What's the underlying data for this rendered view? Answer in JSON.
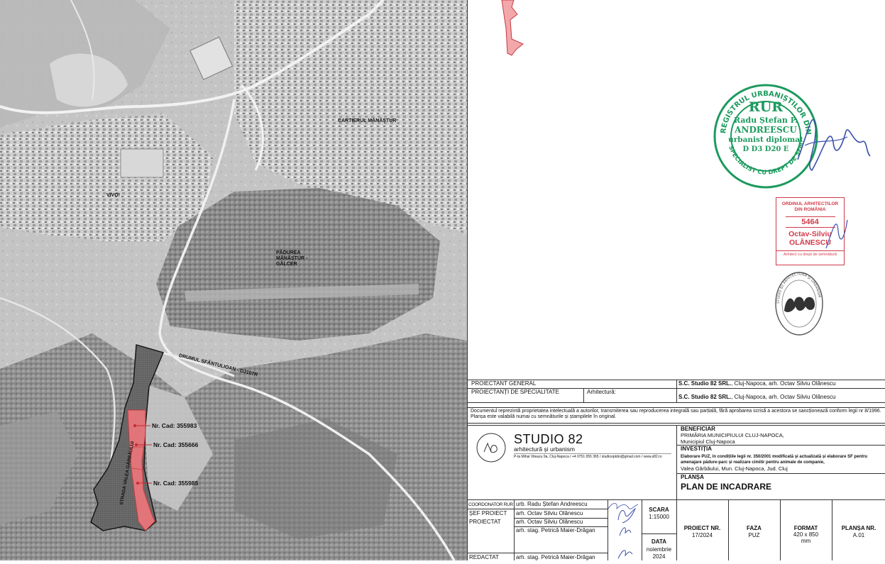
{
  "map": {
    "labels": {
      "cartierul_manastur": "CARTIERUL MĂNĂȘTUR",
      "vivo": "VIVO!",
      "padurea": [
        "PĂDUREA",
        "MĂNĂȘTUR -",
        "GÂLCER"
      ],
      "drumul": "DRUMUL SFÂNTULIOAN - DJ107R",
      "strada": "STRADA VALEA GÂRBĂULUI"
    },
    "cadastral": [
      "Nr. Cad: 355983",
      "Nr. Cad: 355666",
      "Nr. Cad: 355985"
    ]
  },
  "stamps": {
    "rur": {
      "ring_text": "REGISTRUL URBANIȘTILOR DIN ROMÂNIA",
      "ring_bottom": "SPECIALIST CU DREPT DE SEMNĂTURĂ",
      "title": "RUR",
      "name1": "Radu Ștefan P.",
      "name2": "ANDREESCU",
      "role": "urbanist diplomat",
      "codes": "D D3 D20 E"
    },
    "oar": {
      "line1": "ORDINUL ARHITECȚILOR",
      "line2": "DIN ROMÂNIA",
      "number": "5464",
      "name1": "Octav-Silviu",
      "name2": "OLĂNESCU",
      "footer": "Arhitect cu drept de semnătură"
    },
    "company_stamp_text": "STUDIO 82 ARHITECTURĂ ȘI URBANISM"
  },
  "titleblock": {
    "proiectant_general_label": "PROIECTANT GENERAL",
    "proiectant_general_value_bold": "S.C. Studio 82 SRL.",
    "proiectant_general_value": ", Cluj-Napoca, arh. Octav Silviu Olănescu",
    "specialitate_label": "PROIECTANȚI DE SPECIALITATE",
    "specialitate_sub": "Arhitectură:",
    "specialitate_value_bold": "S.C. Studio 82 SRL.",
    "specialitate_value": ", Cluj-Napoca, arh. Octav Silviu Olănescu",
    "disclaimer": "Documentul reprezintă proprietatea intelectuală a autorilor, transmiterea sau reproducerea integrală sau parțială, fără aprobarea scrisă a acestora se sancționează conform legii nr 8/1996. Planșa este valabilă numai cu semnăturile și ștampilele în original.",
    "studio_name": "STUDIO 82",
    "studio_sub": "arhitectură și urbanism",
    "studio_addr": "P-ta Mihai Viteazu 9a, Cluj-Napoca / +4 0751 055 365 / studiooptdoi@gmail.com / www.s82.ro",
    "beneficiar_label": "BENEFICIAR",
    "beneficiar_line1": "PRIMĂRIA MUNICIPIULUI CLUJ-NAPOCA,",
    "beneficiar_line2": "Municipiul Cluj-Napoca",
    "investitia_label": "INVESTIȚIA",
    "investitia_text": "Elaborare PUZ, în condițiile legii nr. 350/2001 modificată și actualizată și elaborare SF pentru amenajare pădure-parc și realizare cimitir pentru animale de companie,",
    "investitia_loc": "Valea Gârbăului, Mun. Cluj-Napoca, Jud. Cluj",
    "plansa_label": "PLANȘA",
    "plansa_title": "PLAN DE INCADRARE",
    "roles": [
      {
        "role": "COORDONATOR RUR",
        "name": "urb. Radu Ștefan Andreescu"
      },
      {
        "role": "ȘEF PROIECT",
        "name": "arh. Octav Silviu Olănescu"
      },
      {
        "role": "PROIECTAT",
        "name": "arh. Octav Silviu Olănescu"
      },
      {
        "role": "",
        "name": "arh. stag. Petrică Maier-Drăgan"
      },
      {
        "role": "REDACTAT",
        "name": "arh. stag. Petrică Maier-Drăgan"
      }
    ],
    "scara_label": "SCARA",
    "scara_value": "1:15000",
    "data_label": "DATA",
    "data_value1": "noiembrie",
    "data_value2": "2024",
    "proiect_nr_label": "PROIECT NR.",
    "proiect_nr_value": "17/2024",
    "faza_label": "FAZA",
    "faza_value": "PUZ",
    "format_label": "FORMAT",
    "format_value1": "420 x  850",
    "format_value2": "mm",
    "plansa_nr_label": "PLANȘA NR.",
    "plansa_nr_value": "A.01"
  },
  "colors": {
    "site_red": "#e8767a",
    "rur_green": "#1c9a5e",
    "oar_red": "#d13a4a",
    "signature_blue": "#3a4fa8"
  }
}
